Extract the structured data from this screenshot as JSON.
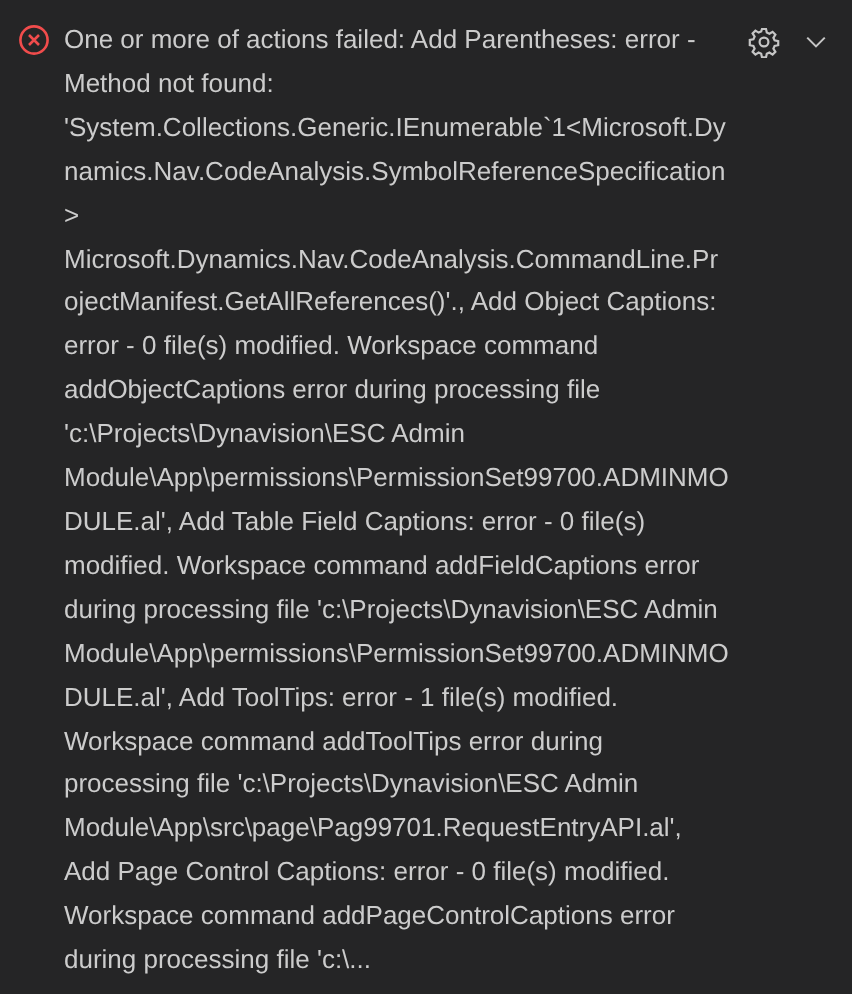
{
  "notification": {
    "message": "One or more of actions failed: Add Parentheses: error - Method not found: 'System.Collections.Generic.IEnumerable`1<Microsoft.Dynamics.Nav.CodeAnalysis.SymbolReferenceSpecification> Microsoft.Dynamics.Nav.CodeAnalysis.CommandLine.ProjectManifest.GetAllReferences()'., Add Object Captions: error - 0 file(s) modified. Workspace command addObjectCaptions error during processing file 'c:\\Projects\\Dynavision\\ESC Admin Module\\App\\permissions\\PermissionSet99700.ADMINMODULE.al', Add Table Field Captions: error - 0 file(s) modified. Workspace command addFieldCaptions error during processing file 'c:\\Projects\\Dynavision\\ESC Admin Module\\App\\permissions\\PermissionSet99700.ADMINMODULE.al', Add ToolTips: error - 1 file(s) modified. Workspace command addToolTips error during processing file 'c:\\Projects\\Dynavision\\ESC Admin Module\\App\\src\\page\\Pag99701.RequestEntryAPI.al', Add Page Control Captions: error - 0 file(s) modified. Workspace command addPageControlCaptions error during processing file 'c:\\...",
    "expanded": false
  }
}
